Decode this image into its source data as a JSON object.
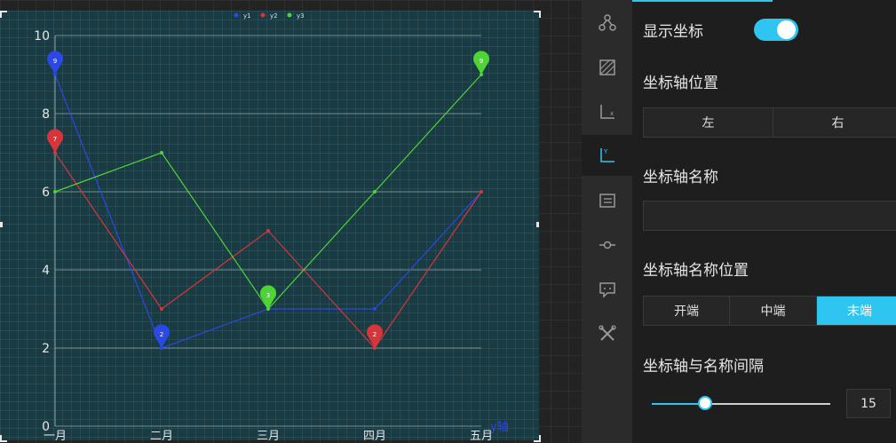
{
  "chart_data": {
    "type": "line",
    "categories": [
      "一月",
      "二月",
      "三月",
      "四月",
      "五月"
    ],
    "ylim": [
      0,
      10
    ],
    "yticks": [
      "0",
      "2",
      "4",
      "6",
      "8",
      "10"
    ],
    "axis_name": "y轴",
    "legend_position": "top-center",
    "grid": true,
    "series": [
      {
        "name": "y1",
        "color": "#2a48e6",
        "values": [
          9,
          2,
          3,
          3,
          6
        ]
      },
      {
        "name": "y2",
        "color": "#d8343c",
        "values": [
          7,
          3,
          5,
          2,
          6
        ]
      },
      {
        "name": "y3",
        "color": "#4fd436",
        "values": [
          6,
          7,
          3,
          6,
          9
        ]
      }
    ],
    "markers": [
      {
        "series": 0,
        "index": 0,
        "label": "9",
        "color": "#2a48e6"
      },
      {
        "series": 0,
        "index": 1,
        "label": "2",
        "color": "#2a48e6"
      },
      {
        "series": 1,
        "index": 0,
        "label": "7",
        "color": "#d8343c"
      },
      {
        "series": 1,
        "index": 3,
        "label": "2",
        "color": "#d8343c"
      },
      {
        "series": 2,
        "index": 2,
        "label": "3",
        "color": "#4fd436"
      },
      {
        "series": 2,
        "index": 4,
        "label": "9",
        "color": "#4fd436"
      }
    ]
  },
  "icons": [
    "nodes-icon",
    "pattern-icon",
    "x-axis-icon",
    "y-axis-icon",
    "legend-list-icon",
    "line-point-icon",
    "tooltip-icon",
    "tools-icon"
  ],
  "active_icon": "y-axis-icon",
  "accent_color": "#2ec5f0",
  "panel": {
    "show_axis_label": "显示坐标",
    "show_axis_on": true,
    "axis_position_label": "坐标轴位置",
    "axis_position_options": [
      "左",
      "右"
    ],
    "axis_name_label": "坐标轴名称",
    "axis_name_value": "",
    "axis_name_position_label": "坐标轴名称位置",
    "axis_name_position_options": [
      "开端",
      "中端",
      "末端"
    ],
    "axis_name_position_selected": 2,
    "gap_label": "坐标轴与名称间隔",
    "gap_value": "15",
    "gap_fraction": 0.3
  }
}
